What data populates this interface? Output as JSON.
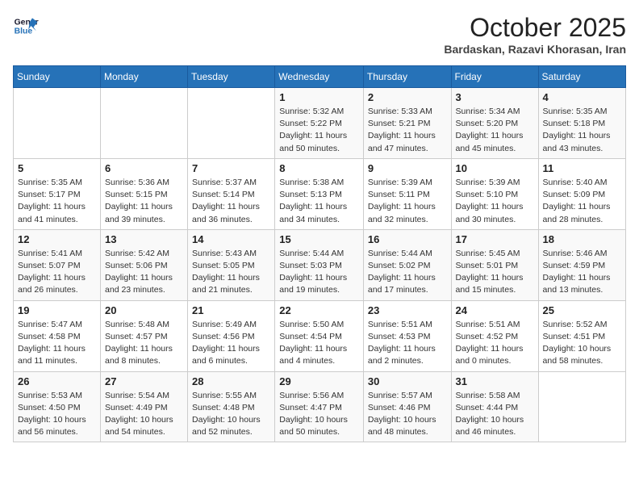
{
  "header": {
    "logo": {
      "line1": "General",
      "line2": "Blue"
    },
    "title": "October 2025",
    "location": "Bardaskan, Razavi Khorasan, Iran"
  },
  "weekdays": [
    "Sunday",
    "Monday",
    "Tuesday",
    "Wednesday",
    "Thursday",
    "Friday",
    "Saturday"
  ],
  "weeks": [
    [
      {
        "day": "",
        "info": ""
      },
      {
        "day": "",
        "info": ""
      },
      {
        "day": "",
        "info": ""
      },
      {
        "day": "1",
        "info": "Sunrise: 5:32 AM\nSunset: 5:22 PM\nDaylight: 11 hours and 50 minutes."
      },
      {
        "day": "2",
        "info": "Sunrise: 5:33 AM\nSunset: 5:21 PM\nDaylight: 11 hours and 47 minutes."
      },
      {
        "day": "3",
        "info": "Sunrise: 5:34 AM\nSunset: 5:20 PM\nDaylight: 11 hours and 45 minutes."
      },
      {
        "day": "4",
        "info": "Sunrise: 5:35 AM\nSunset: 5:18 PM\nDaylight: 11 hours and 43 minutes."
      }
    ],
    [
      {
        "day": "5",
        "info": "Sunrise: 5:35 AM\nSunset: 5:17 PM\nDaylight: 11 hours and 41 minutes."
      },
      {
        "day": "6",
        "info": "Sunrise: 5:36 AM\nSunset: 5:15 PM\nDaylight: 11 hours and 39 minutes."
      },
      {
        "day": "7",
        "info": "Sunrise: 5:37 AM\nSunset: 5:14 PM\nDaylight: 11 hours and 36 minutes."
      },
      {
        "day": "8",
        "info": "Sunrise: 5:38 AM\nSunset: 5:13 PM\nDaylight: 11 hours and 34 minutes."
      },
      {
        "day": "9",
        "info": "Sunrise: 5:39 AM\nSunset: 5:11 PM\nDaylight: 11 hours and 32 minutes."
      },
      {
        "day": "10",
        "info": "Sunrise: 5:39 AM\nSunset: 5:10 PM\nDaylight: 11 hours and 30 minutes."
      },
      {
        "day": "11",
        "info": "Sunrise: 5:40 AM\nSunset: 5:09 PM\nDaylight: 11 hours and 28 minutes."
      }
    ],
    [
      {
        "day": "12",
        "info": "Sunrise: 5:41 AM\nSunset: 5:07 PM\nDaylight: 11 hours and 26 minutes."
      },
      {
        "day": "13",
        "info": "Sunrise: 5:42 AM\nSunset: 5:06 PM\nDaylight: 11 hours and 23 minutes."
      },
      {
        "day": "14",
        "info": "Sunrise: 5:43 AM\nSunset: 5:05 PM\nDaylight: 11 hours and 21 minutes."
      },
      {
        "day": "15",
        "info": "Sunrise: 5:44 AM\nSunset: 5:03 PM\nDaylight: 11 hours and 19 minutes."
      },
      {
        "day": "16",
        "info": "Sunrise: 5:44 AM\nSunset: 5:02 PM\nDaylight: 11 hours and 17 minutes."
      },
      {
        "day": "17",
        "info": "Sunrise: 5:45 AM\nSunset: 5:01 PM\nDaylight: 11 hours and 15 minutes."
      },
      {
        "day": "18",
        "info": "Sunrise: 5:46 AM\nSunset: 4:59 PM\nDaylight: 11 hours and 13 minutes."
      }
    ],
    [
      {
        "day": "19",
        "info": "Sunrise: 5:47 AM\nSunset: 4:58 PM\nDaylight: 11 hours and 11 minutes."
      },
      {
        "day": "20",
        "info": "Sunrise: 5:48 AM\nSunset: 4:57 PM\nDaylight: 11 hours and 8 minutes."
      },
      {
        "day": "21",
        "info": "Sunrise: 5:49 AM\nSunset: 4:56 PM\nDaylight: 11 hours and 6 minutes."
      },
      {
        "day": "22",
        "info": "Sunrise: 5:50 AM\nSunset: 4:54 PM\nDaylight: 11 hours and 4 minutes."
      },
      {
        "day": "23",
        "info": "Sunrise: 5:51 AM\nSunset: 4:53 PM\nDaylight: 11 hours and 2 minutes."
      },
      {
        "day": "24",
        "info": "Sunrise: 5:51 AM\nSunset: 4:52 PM\nDaylight: 11 hours and 0 minutes."
      },
      {
        "day": "25",
        "info": "Sunrise: 5:52 AM\nSunset: 4:51 PM\nDaylight: 10 hours and 58 minutes."
      }
    ],
    [
      {
        "day": "26",
        "info": "Sunrise: 5:53 AM\nSunset: 4:50 PM\nDaylight: 10 hours and 56 minutes."
      },
      {
        "day": "27",
        "info": "Sunrise: 5:54 AM\nSunset: 4:49 PM\nDaylight: 10 hours and 54 minutes."
      },
      {
        "day": "28",
        "info": "Sunrise: 5:55 AM\nSunset: 4:48 PM\nDaylight: 10 hours and 52 minutes."
      },
      {
        "day": "29",
        "info": "Sunrise: 5:56 AM\nSunset: 4:47 PM\nDaylight: 10 hours and 50 minutes."
      },
      {
        "day": "30",
        "info": "Sunrise: 5:57 AM\nSunset: 4:46 PM\nDaylight: 10 hours and 48 minutes."
      },
      {
        "day": "31",
        "info": "Sunrise: 5:58 AM\nSunset: 4:44 PM\nDaylight: 10 hours and 46 minutes."
      },
      {
        "day": "",
        "info": ""
      }
    ]
  ]
}
